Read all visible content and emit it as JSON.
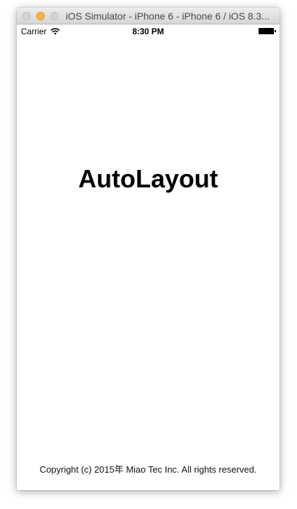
{
  "window": {
    "title": "iOS Simulator - iPhone 6 - iPhone 6 / iOS 8.3..."
  },
  "statusbar": {
    "carrier": "Carrier",
    "time": "8:30 PM",
    "wifi_icon": "wifi-icon",
    "battery_icon": "battery-icon"
  },
  "main": {
    "headline": "AutoLayout",
    "copyright": "Copyright (c) 2015年 Miao Tec Inc. All rights reserved."
  },
  "colors": {
    "minimize_button": "#f5b63e",
    "inactive_button": "#d4d4d4",
    "background": "#ffffff"
  }
}
